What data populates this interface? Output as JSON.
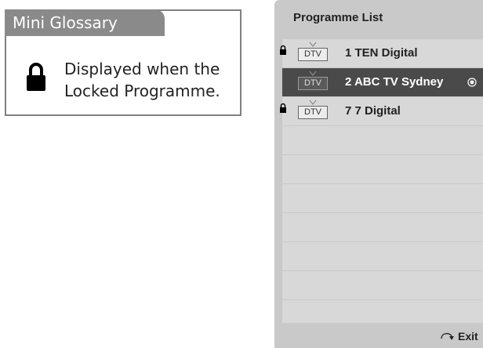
{
  "glossary": {
    "title": "Mini Glossary",
    "lock_icon": "lock-icon",
    "description_line1": "Displayed when the",
    "description_line2": "Locked Programme."
  },
  "programme_list": {
    "title": "Programme List",
    "rows": [
      {
        "locked": true,
        "type": "DTV",
        "name": "1 TEN Digital",
        "selected": false
      },
      {
        "locked": false,
        "type": "DTV",
        "name": "2 ABC TV Sydney",
        "selected": true
      },
      {
        "locked": true,
        "type": "DTV",
        "name": "7 7 Digital",
        "selected": false
      },
      {
        "empty": true
      },
      {
        "empty": true
      },
      {
        "empty": true
      },
      {
        "empty": true
      },
      {
        "empty": true
      },
      {
        "empty": true
      },
      {
        "empty": true
      }
    ],
    "exit_label": "Exit",
    "exit_icon": "return-arrow-icon"
  },
  "colors": {
    "glossary_tab": "#8a8a8a",
    "panel_bg": "#c9c9c9",
    "row_bg": "#d8d8d8",
    "selected_row_bg": "#4a4a4a"
  }
}
